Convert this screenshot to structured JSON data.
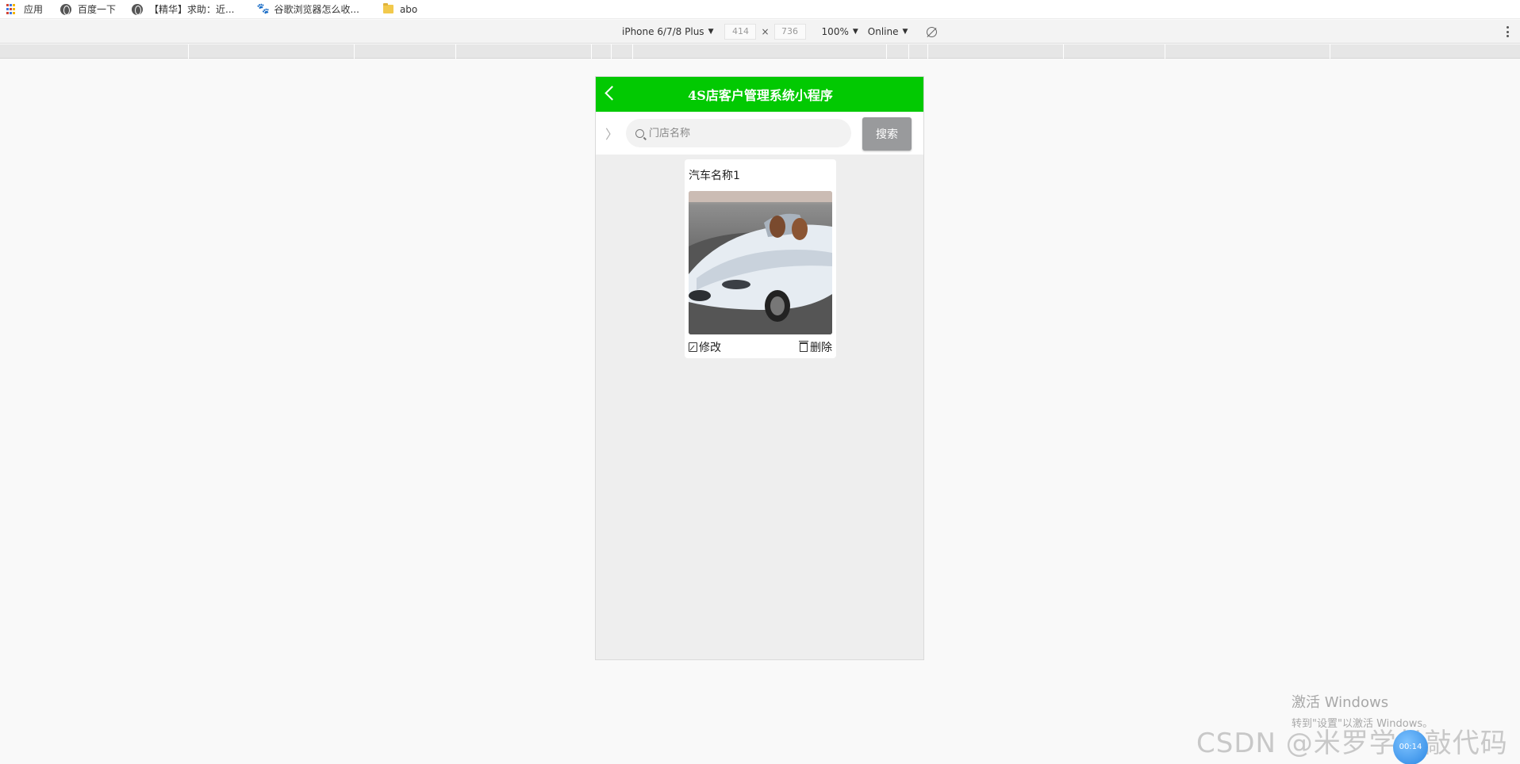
{
  "bookmarks": [
    {
      "label": "应用",
      "icon": "apps-grid-icon"
    },
    {
      "label": "百度一下",
      "icon": "globe-icon"
    },
    {
      "label": "【精华】求助：近...",
      "icon": "globe-icon"
    },
    {
      "label": "谷歌浏览器怎么收...",
      "icon": "paw-icon"
    },
    {
      "label": "abo",
      "icon": "folder-icon"
    }
  ],
  "device_toolbar": {
    "device": "iPhone 6/7/8 Plus",
    "width": "414",
    "height": "736",
    "times": "×",
    "zoom": "100%",
    "network": "Online"
  },
  "app": {
    "title": "4S店客户管理系统小程序",
    "accent_color": "#02c902",
    "search": {
      "placeholder": "门店名称",
      "button_label": "搜索"
    },
    "cards": [
      {
        "name": "汽车名称1",
        "edit_label": "修改",
        "delete_label": "删除"
      }
    ]
  },
  "watermarks": {
    "activate_title": "激活 Windows",
    "activate_sub": "转到\"设置\"以激活 Windows。",
    "csdn": "CSDN @米罗学长敲代码",
    "bubble": "00:14"
  }
}
